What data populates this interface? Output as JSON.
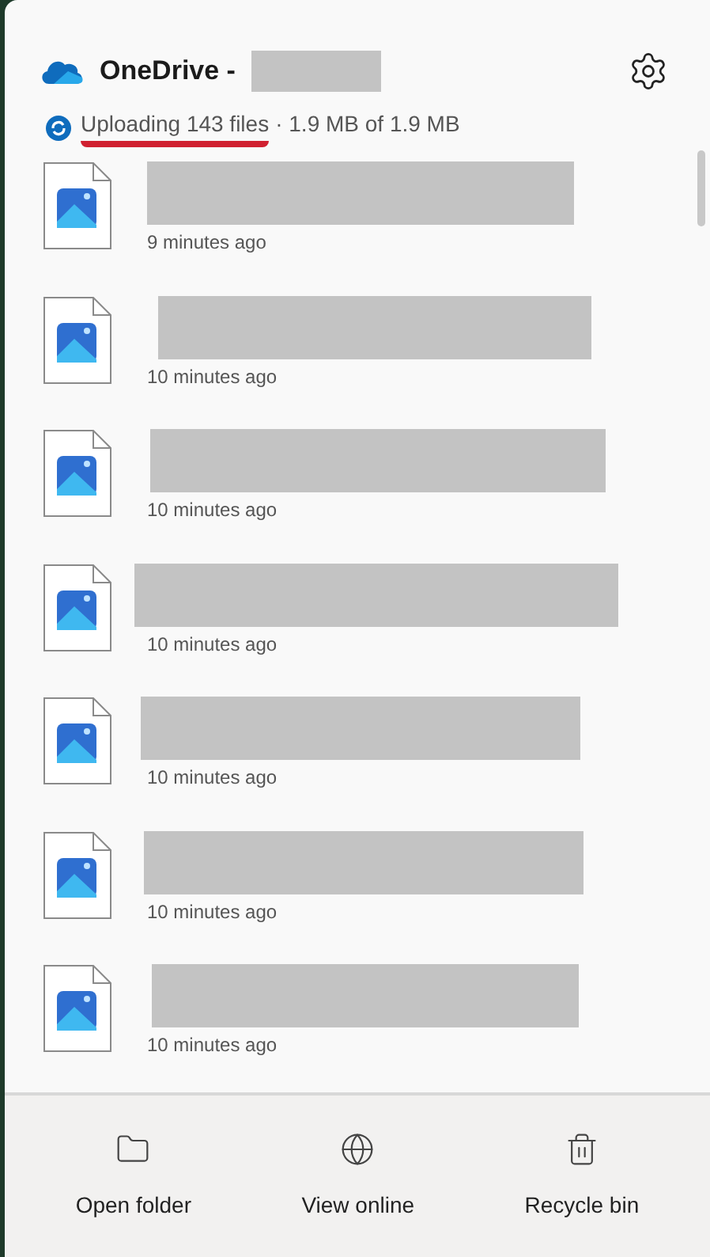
{
  "header": {
    "title": "OneDrive -"
  },
  "status": {
    "label": "Uploading 143 files",
    "detail": "· 1.9 MB of 1.9 MB"
  },
  "files": [
    {
      "kind": "image",
      "time": "9 minutes ago"
    },
    {
      "kind": "image",
      "time": "10 minutes ago"
    },
    {
      "kind": "image",
      "time": "10 minutes ago"
    },
    {
      "kind": "image",
      "time": "10 minutes ago"
    },
    {
      "kind": "image",
      "time": "10 minutes ago"
    },
    {
      "kind": "image",
      "time": "10 minutes ago"
    },
    {
      "kind": "image",
      "time": "10 minutes ago"
    }
  ],
  "actions": [
    {
      "kind": "folder",
      "label": "Open folder"
    },
    {
      "kind": "globe",
      "label": "View online"
    },
    {
      "kind": "trash",
      "label": "Recycle bin"
    }
  ]
}
